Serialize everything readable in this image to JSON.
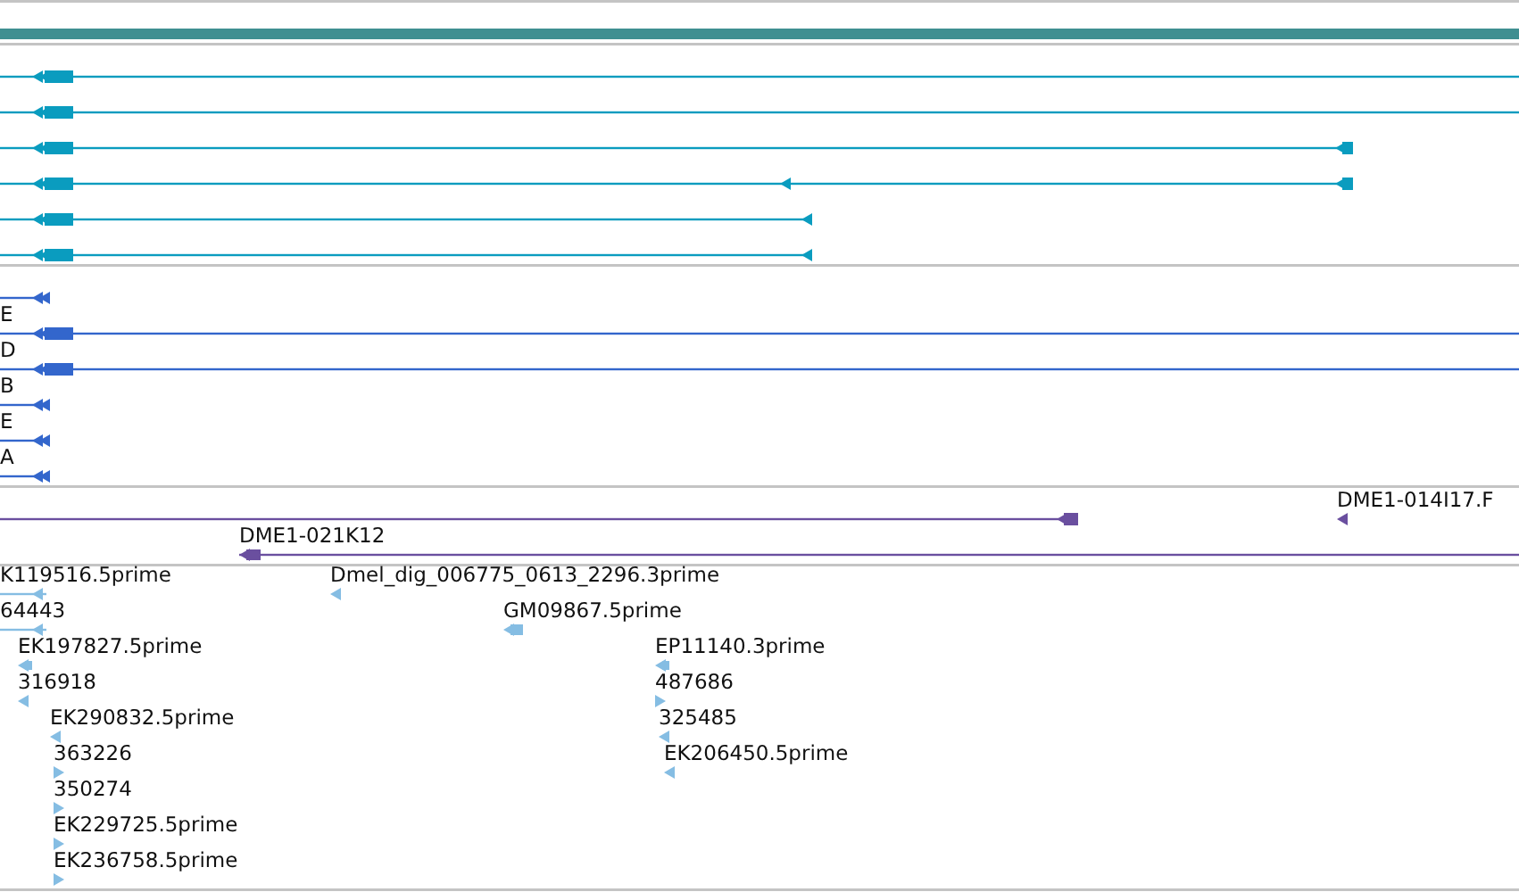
{
  "tracks": [
    {
      "color": "#0a9cbf",
      "features": [
        {
          "reverse": true
        },
        {
          "reverse": true
        },
        {
          "reverse": true
        },
        {
          "reverse": true
        },
        {
          "reverse": true
        },
        {
          "reverse": true
        }
      ]
    },
    {
      "color": "#3366cc",
      "features": [
        {
          "reverse": true
        },
        {
          "label": "E",
          "reverse": true
        },
        {
          "label": "D",
          "reverse": true
        },
        {
          "label": "B",
          "reverse": true
        },
        {
          "label": "E",
          "reverse": true
        },
        {
          "label": "A",
          "reverse": true
        }
      ]
    },
    {
      "color": "#6a4f9f",
      "features": [
        {
          "reverse": true
        },
        {
          "label": "DME1-014I17.F",
          "reverse": true
        },
        {
          "label": "DME1-021K12",
          "reverse": true
        }
      ]
    },
    {
      "color": "#85bde3",
      "features": [
        {
          "label": "K119516.5prime",
          "reverse": true
        },
        {
          "label": "Dmel_dig_006775_0613_2296.3prime",
          "reverse": true
        },
        {
          "label": "64443",
          "reverse": true
        },
        {
          "label": "GM09867.5prime",
          "reverse": true
        },
        {
          "label": "EK197827.5prime",
          "reverse": true
        },
        {
          "label": "EP11140.3prime",
          "reverse": true
        },
        {
          "label": "316918",
          "reverse": true
        },
        {
          "label": "487686",
          "reverse": false
        },
        {
          "label": "EK290832.5prime",
          "reverse": true
        },
        {
          "label": "325485",
          "reverse": true
        },
        {
          "label": "363226",
          "reverse": false
        },
        {
          "label": "EK206450.5prime",
          "reverse": true
        },
        {
          "label": "350274",
          "reverse": false
        },
        {
          "label": "EK229725.5prime",
          "reverse": false
        },
        {
          "label": "EK236758.5prime",
          "reverse": false
        }
      ]
    }
  ]
}
